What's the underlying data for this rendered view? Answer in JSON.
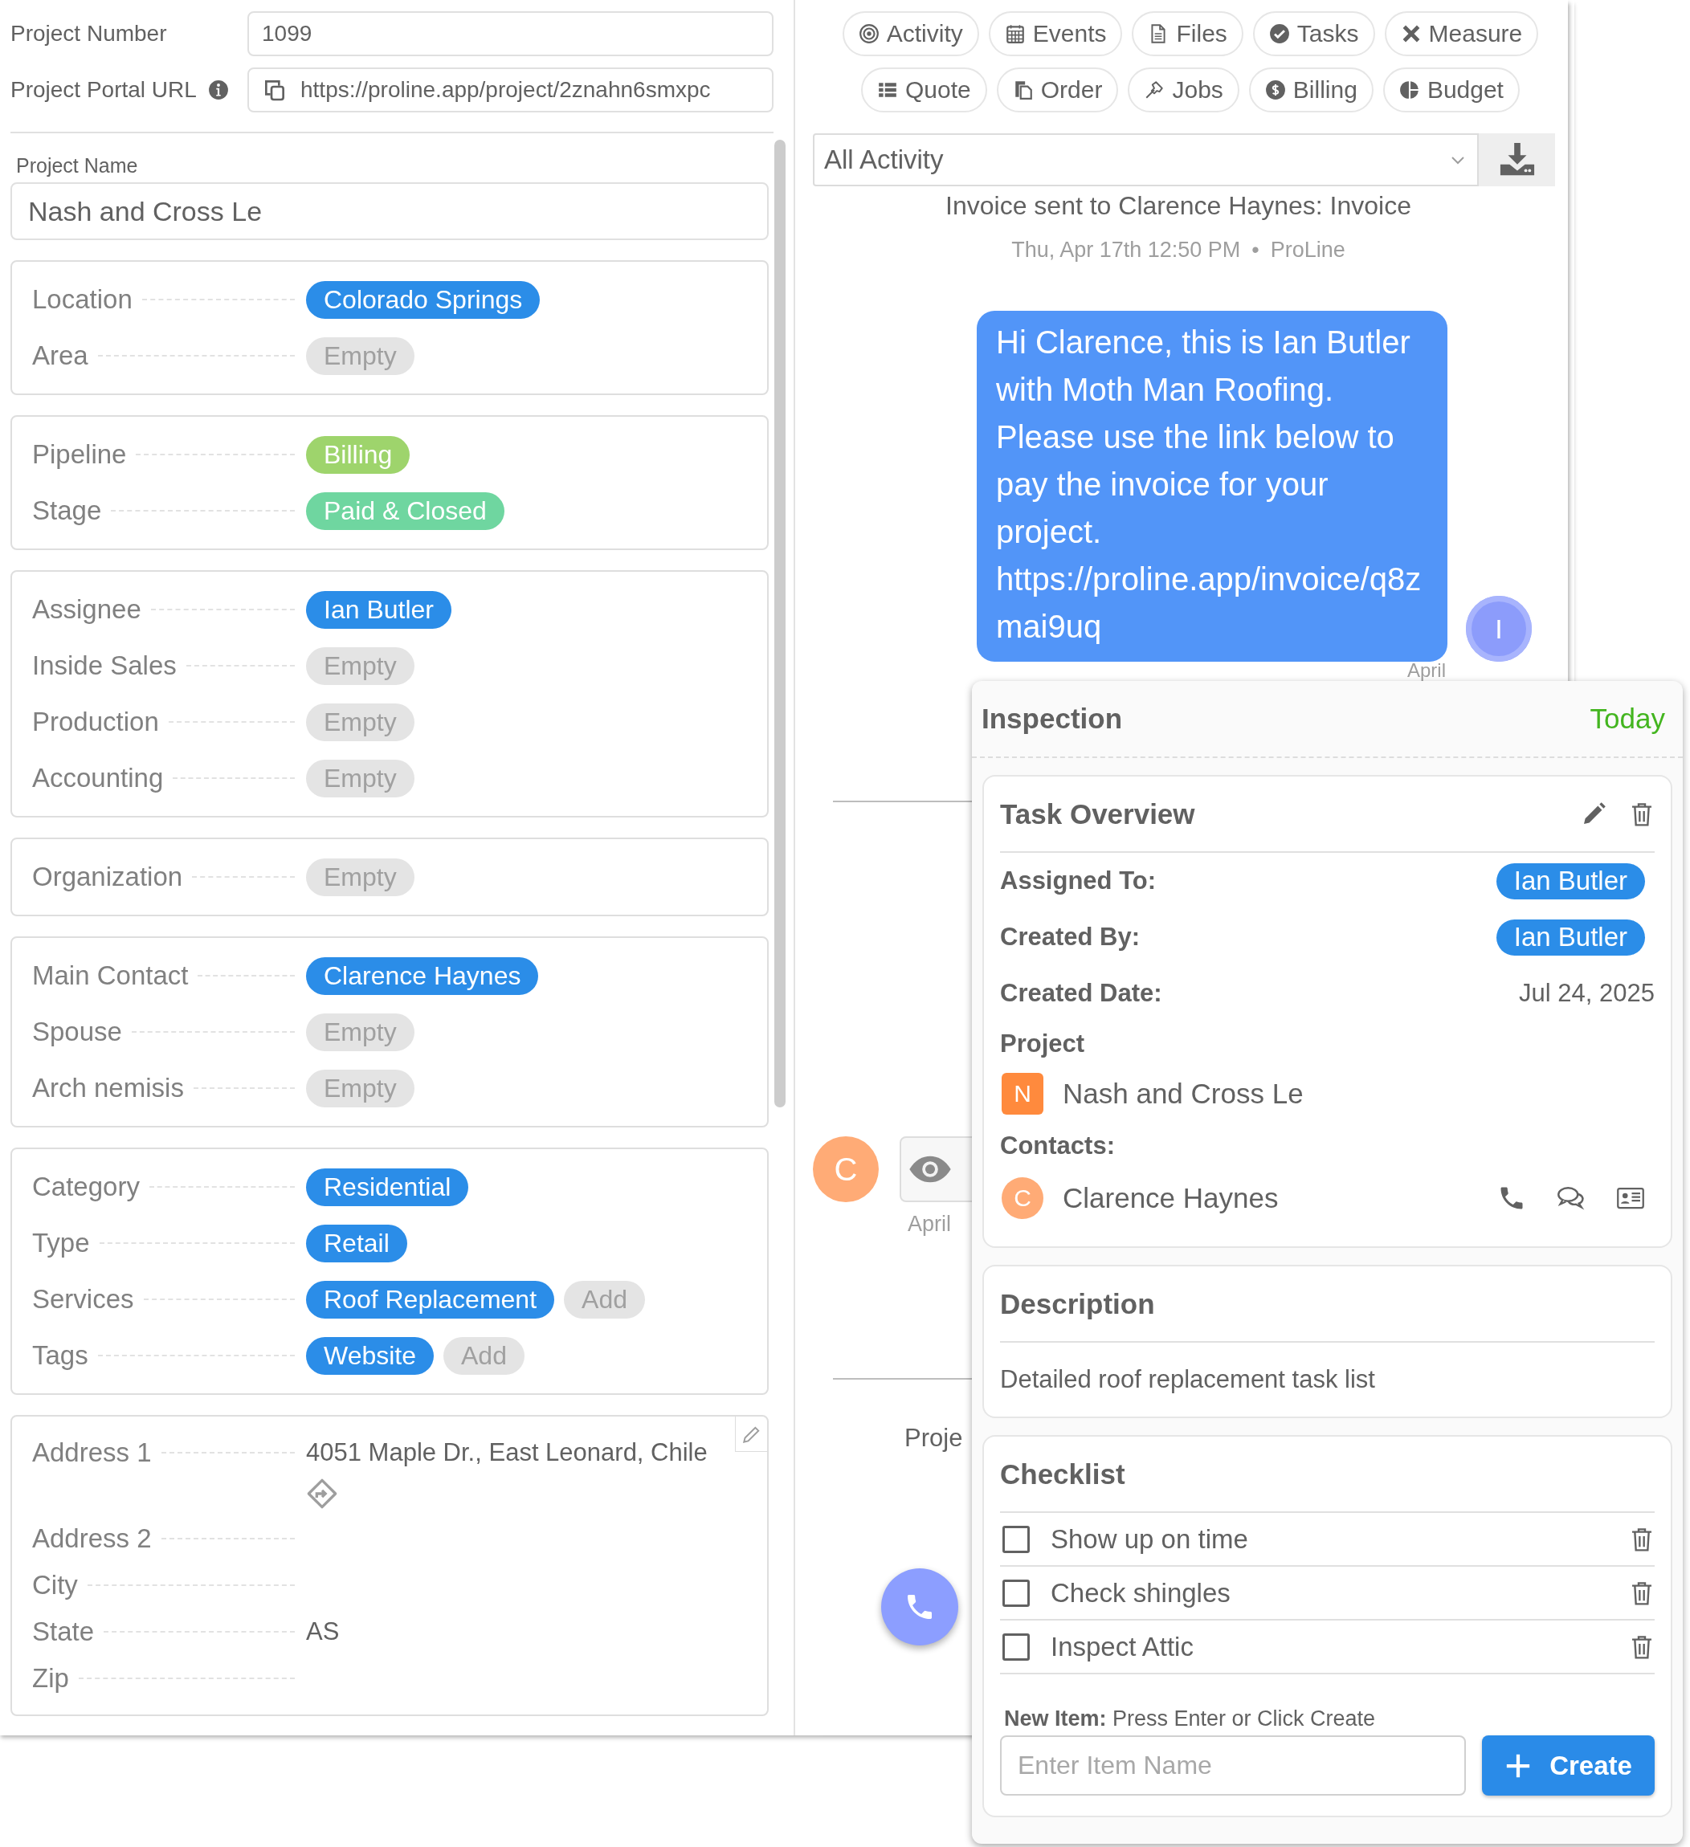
{
  "project_number": {
    "label": "Project Number",
    "value": "1099"
  },
  "portal_url": {
    "label": "Project Portal URL",
    "value": "https://proline.app/project/2znahn6smxpc"
  },
  "project_name": {
    "label": "Project Name",
    "value": "Nash and Cross Le"
  },
  "groups": [
    {
      "rows": [
        {
          "label": "Location",
          "chips": [
            {
              "kind": "value",
              "text": "Colorado Springs",
              "color": "#2b8de8"
            }
          ]
        },
        {
          "label": "Area",
          "chips": [
            {
              "kind": "muted",
              "text": "Empty"
            }
          ]
        }
      ]
    },
    {
      "rows": [
        {
          "label": "Pipeline",
          "chips": [
            {
              "kind": "value",
              "text": "Billing",
              "color": "#9ed46c"
            }
          ]
        },
        {
          "label": "Stage",
          "chips": [
            {
              "kind": "value",
              "text": "Paid & Closed",
              "color": "#6fd6a0"
            }
          ]
        }
      ]
    },
    {
      "rows": [
        {
          "label": "Assignee",
          "chips": [
            {
              "kind": "value",
              "text": "Ian Butler",
              "color": "#2b8de8"
            }
          ]
        },
        {
          "label": "Inside Sales",
          "chips": [
            {
              "kind": "muted",
              "text": "Empty"
            }
          ]
        },
        {
          "label": "Production",
          "chips": [
            {
              "kind": "muted",
              "text": "Empty"
            }
          ]
        },
        {
          "label": "Accounting",
          "chips": [
            {
              "kind": "muted",
              "text": "Empty"
            }
          ]
        }
      ]
    },
    {
      "rows": [
        {
          "label": "Organization",
          "chips": [
            {
              "kind": "muted",
              "text": "Empty"
            }
          ]
        }
      ]
    },
    {
      "rows": [
        {
          "label": "Main Contact",
          "chips": [
            {
              "kind": "value",
              "text": "Clarence Haynes",
              "color": "#2b8de8"
            }
          ]
        },
        {
          "label": "Spouse",
          "chips": [
            {
              "kind": "muted",
              "text": "Empty"
            }
          ]
        },
        {
          "label": "Arch nemisis",
          "chips": [
            {
              "kind": "muted",
              "text": "Empty"
            }
          ]
        }
      ]
    },
    {
      "rows": [
        {
          "label": "Category",
          "chips": [
            {
              "kind": "value",
              "text": "Residential",
              "color": "#2b8de8"
            }
          ]
        },
        {
          "label": "Type",
          "chips": [
            {
              "kind": "value",
              "text": "Retail",
              "color": "#2b8de8"
            }
          ]
        },
        {
          "label": "Services",
          "chips": [
            {
              "kind": "value",
              "text": "Roof Replacement",
              "color": "#2b8de8"
            },
            {
              "kind": "muted",
              "text": "Add"
            }
          ]
        },
        {
          "label": "Tags",
          "chips": [
            {
              "kind": "value",
              "text": "Website",
              "color": "#2b8de8"
            },
            {
              "kind": "muted",
              "text": "Add"
            }
          ]
        }
      ]
    }
  ],
  "address": {
    "rows": [
      {
        "label": "Address 1",
        "value": "4051 Maple Dr., East Leonard, Chile",
        "directions": true
      },
      {
        "label": "Address 2",
        "directions": false
      },
      {
        "label": "City",
        "directions": false
      },
      {
        "label": "State",
        "value": "AS",
        "directions": false
      },
      {
        "label": "Zip",
        "directions": false
      }
    ]
  },
  "tab_rows": [
    [
      "Activity",
      "Events",
      "Files",
      "Tasks",
      "Measure"
    ],
    [
      "Quote",
      "Order",
      "Jobs",
      "Billing",
      "Budget"
    ]
  ],
  "activity_filter": "All Activity",
  "feed": {
    "event": "Invoice sent to Clarence Haynes: Invoice",
    "event_time": "Thu, Apr 17th 12:50 PM",
    "event_separator": "•",
    "event_source": "ProLine",
    "message": "Hi Clarence, this is Ian Butler with Moth Man Roofing. Please use the link below to pay the invoice for your project. https://proline.app/invoice/q8zmai9uq",
    "message_avatar": "I",
    "message_date": "April",
    "contact_avatar": "C",
    "contact_date": "April",
    "project_text": "Proje"
  },
  "task": {
    "title": "Inspection",
    "due": "Today",
    "overview": {
      "title": "Task Overview",
      "assigned_label": "Assigned To:",
      "assigned": "Ian Butler",
      "created_by_label": "Created By:",
      "created_by": "Ian Butler",
      "created_date_label": "Created Date:",
      "created_date": "Jul 24, 2025",
      "project_label": "Project",
      "project_initial": "N",
      "project": "Nash and Cross Le",
      "contacts_label": "Contacts:",
      "contacts": [
        {
          "initial": "C",
          "name": "Clarence Haynes"
        }
      ]
    },
    "description": {
      "title": "Description",
      "text": "Detailed roof replacement task list"
    },
    "checklist": {
      "title": "Checklist",
      "items": [
        {
          "text": "Show up on time",
          "checked": false
        },
        {
          "text": "Check shingles",
          "checked": false
        },
        {
          "text": "Inspect Attic",
          "checked": false
        }
      ],
      "hint": "**New Item:** Press Enter or Click Create",
      "placeholder": "Enter Item Name",
      "create": "Create"
    }
  }
}
